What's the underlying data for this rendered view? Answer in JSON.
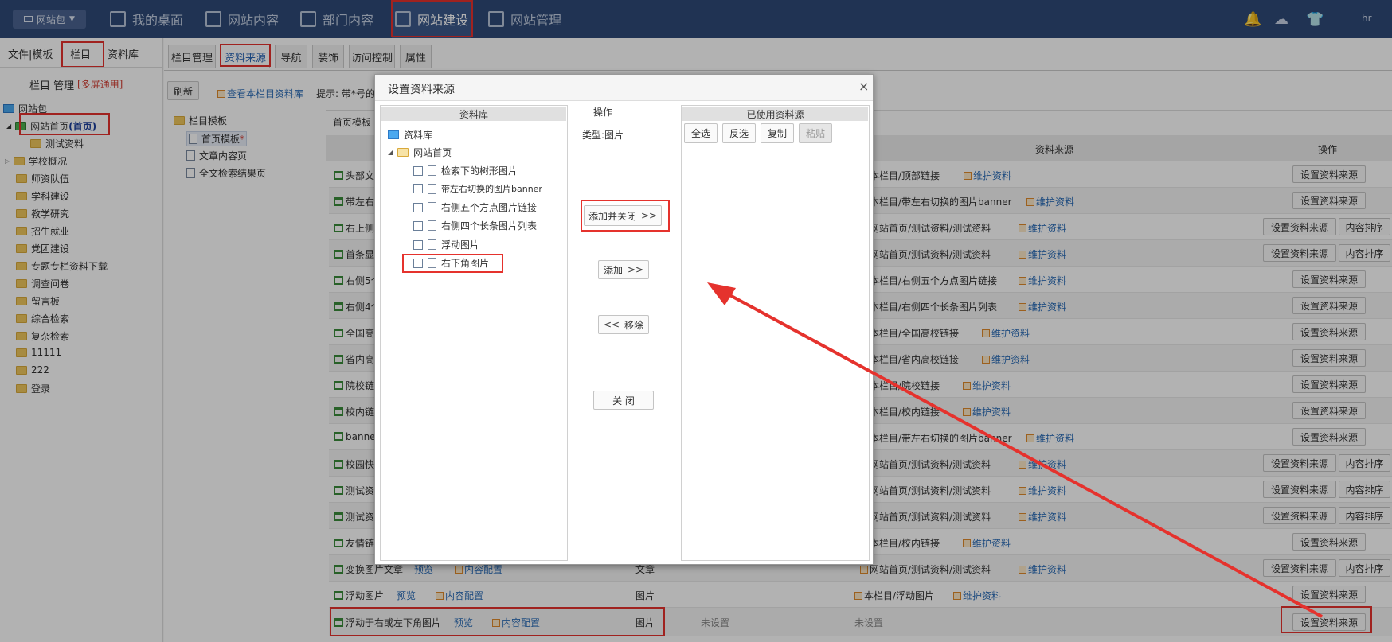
{
  "topbar": {
    "site_button": "网站包",
    "nav": [
      "我的桌面",
      "网站内容",
      "部门内容",
      "网站建设",
      "网站管理"
    ],
    "user": "hr"
  },
  "left": {
    "tabs": [
      "文件|模板",
      "栏目",
      "资料库"
    ],
    "title": "栏目 管理",
    "title_tag": "[多屏通用]",
    "tree_root": "网站包",
    "home_label": "网站首页",
    "home_tag": "(首页)",
    "items": [
      "测试资料",
      "学校概况",
      "师资队伍",
      "学科建设",
      "教学研究",
      "招生就业",
      "党团建设",
      "专题专栏资料下载",
      "调查问卷",
      "留言板",
      "综合检索",
      "复杂检索",
      "11111",
      "222",
      "登录"
    ]
  },
  "main": {
    "tabs": [
      "栏目管理",
      "资料来源",
      "导航",
      "装饰",
      "访问控制",
      "属性"
    ],
    "refresh": "刷新",
    "view_link": "查看本栏目资料库",
    "hint": "提示: 带*号的",
    "template_tree": {
      "root": "栏目模板",
      "items": [
        "首页模板",
        "文章内容页",
        "全文检索结果页"
      ]
    },
    "table_title": "首页模板",
    "headers": {
      "source": "资料来源",
      "ops": "操作"
    },
    "rows": [
      {
        "name": "头部文",
        "source": "本栏目/顶部链接",
        "maintain": "维护资料",
        "ops": [
          "设置资料来源"
        ]
      },
      {
        "name": "带左右",
        "source": "本栏目/带左右切换的图片banner",
        "maintain": "维护资料",
        "ops": [
          "设置资料来源"
        ]
      },
      {
        "name": "右上侧",
        "source": "网站首页/测试资料/测试资料",
        "maintain": "维护资料",
        "ops": [
          "设置资料来源",
          "内容排序"
        ]
      },
      {
        "name": "首条显",
        "source": "网站首页/测试资料/测试资料",
        "maintain": "维护资料",
        "ops": [
          "设置资料来源",
          "内容排序"
        ]
      },
      {
        "name": "右侧5个",
        "source": "本栏目/右侧五个方点图片链接",
        "maintain": "维护资料",
        "ops": [
          "设置资料来源"
        ]
      },
      {
        "name": "右侧4个",
        "source": "本栏目/右侧四个长条图片列表",
        "maintain": "维护资料",
        "ops": [
          "设置资料来源"
        ]
      },
      {
        "name": "全国高",
        "source": "本栏目/全国高校链接",
        "maintain": "维护资料",
        "ops": [
          "设置资料来源"
        ]
      },
      {
        "name": "省内高",
        "source": "本栏目/省内高校链接",
        "maintain": "维护资料",
        "ops": [
          "设置资料来源"
        ]
      },
      {
        "name": "院校链",
        "source": "本栏目/院校链接",
        "maintain": "维护资料",
        "ops": [
          "设置资料来源"
        ]
      },
      {
        "name": "校内链",
        "source": "本栏目/校内链接",
        "maintain": "维护资料",
        "ops": [
          "设置资料来源"
        ]
      },
      {
        "name": "banner",
        "source": "本栏目/带左右切换的图片banner",
        "maintain": "维护资料",
        "ops": [
          "设置资料来源"
        ]
      },
      {
        "name": "校园快",
        "source": "网站首页/测试资料/测试资料",
        "maintain": "维护资料",
        "ops": [
          "设置资料来源",
          "内容排序"
        ]
      },
      {
        "name": "测试资",
        "source": "网站首页/测试资料/测试资料",
        "maintain": "维护资料",
        "ops": [
          "设置资料来源",
          "内容排序"
        ]
      },
      {
        "name": "测试资",
        "source": "网站首页/测试资料/测试资料",
        "maintain": "维护资料",
        "ops": [
          "设置资料来源",
          "内容排序"
        ]
      },
      {
        "name": "友情链",
        "source": "本栏目/校内链接",
        "maintain": "维护资料",
        "ops": [
          "设置资料来源"
        ]
      },
      {
        "name": "变换图片文章",
        "preview": "预览",
        "config": "内容配置",
        "type": "文章",
        "source": "网站首页/测试资料/测试资料",
        "maintain": "维护资料",
        "ops": [
          "设置资料来源",
          "内容排序"
        ]
      },
      {
        "name": "浮动图片",
        "preview": "预览",
        "config": "内容配置",
        "type": "图片",
        "source": "本栏目/浮动图片",
        "maintain": "维护资料",
        "ops": [
          "设置资料来源"
        ]
      },
      {
        "name": "浮动于右或左下角图片",
        "preview": "预览",
        "config": "内容配置",
        "type": "图片",
        "unset1": "未设置",
        "source": "未设置",
        "ops": [
          "设置资料来源"
        ]
      }
    ]
  },
  "modal": {
    "title": "设置资料来源",
    "close": "×",
    "col_library": "资料库",
    "col_ops": "操作",
    "col_used": "已使用资料源",
    "type_label": "类型:图片",
    "tree_root": "资料库",
    "tree_site": "网站首页",
    "tree_items": [
      "检索下的树形图片",
      "带左右切换的图片banner",
      "右侧五个方点图片链接",
      "右侧四个长条图片列表",
      "浮动图片",
      "右下角图片"
    ],
    "btn_add_close": "添加并关闭",
    "btn_add": "添加",
    "btn_remove": "移除",
    "btn_close": "关 闭",
    "used_buttons": [
      "全选",
      "反选",
      "复制",
      "粘贴"
    ]
  }
}
